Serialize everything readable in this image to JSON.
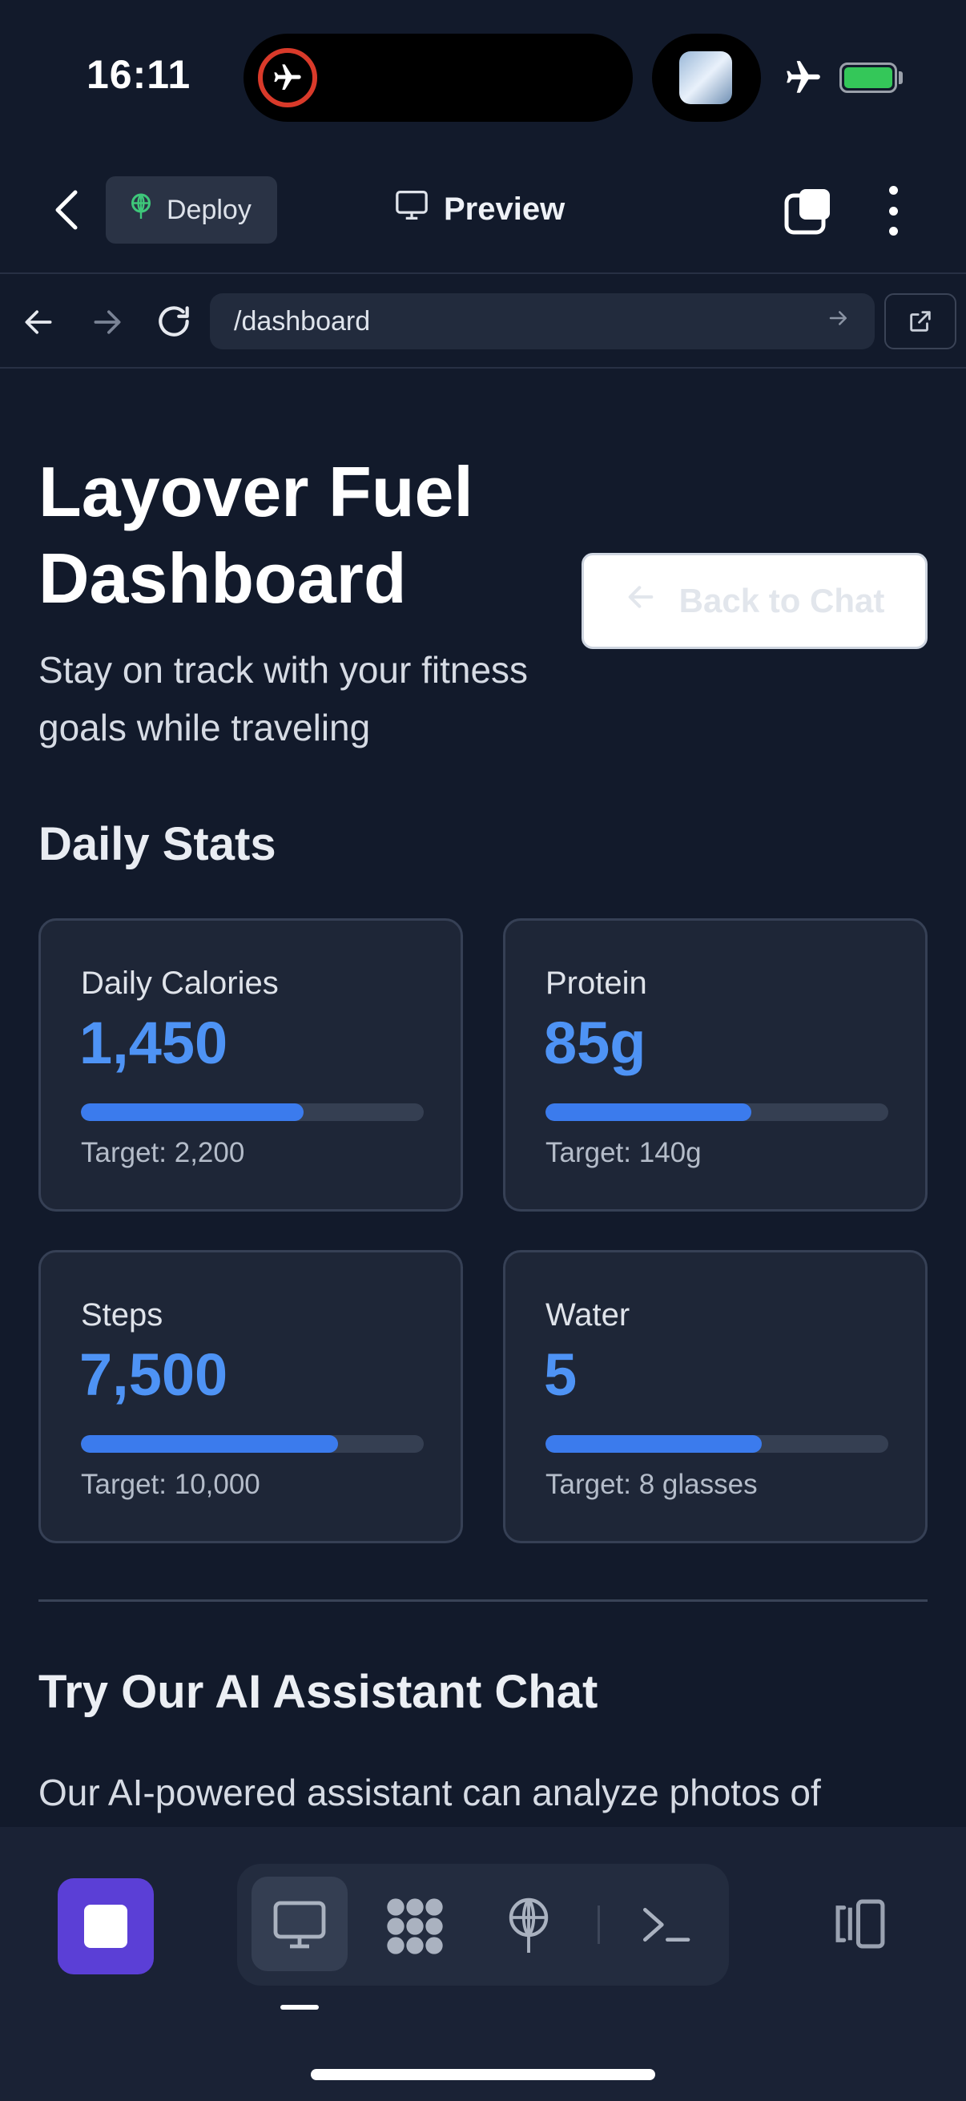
{
  "status": {
    "time": "16:11"
  },
  "header": {
    "deploy_label": "Deploy",
    "preview_label": "Preview"
  },
  "browser": {
    "url": "/dashboard"
  },
  "page": {
    "title": "Layover Fuel Dashboard",
    "back_button": "Back to Chat",
    "subtitle": "Stay on track with your fitness goals while traveling",
    "stats_heading": "Daily Stats",
    "stats": [
      {
        "label": "Daily Calories",
        "value": "1,450",
        "target": "Target: 2,200",
        "progress": 0.65
      },
      {
        "label": "Protein",
        "value": "85g",
        "target": "Target: 140g",
        "progress": 0.6
      },
      {
        "label": "Steps",
        "value": "7,500",
        "target": "Target: 10,000",
        "progress": 0.75
      },
      {
        "label": "Water",
        "value": "5",
        "target": "Target: 8 glasses",
        "progress": 0.63
      }
    ],
    "assistant_heading": "Try Our AI Assistant Chat",
    "assistant_desc": "Our AI-powered assistant can analyze photos of"
  },
  "colors": {
    "accent": "#4e93f5",
    "stop_button": "#5b3fd6",
    "background": "#121a2b"
  },
  "icons": [
    "airplane-icon",
    "battery-icon",
    "chevron-left-icon",
    "deploy-icon",
    "monitor-icon",
    "tabs-icon",
    "more-icon",
    "arrow-left-icon",
    "arrow-right-icon",
    "reload-icon",
    "external-link-icon",
    "stop-icon",
    "grid-icon",
    "terminal-icon",
    "sidebar-toggle-icon"
  ]
}
